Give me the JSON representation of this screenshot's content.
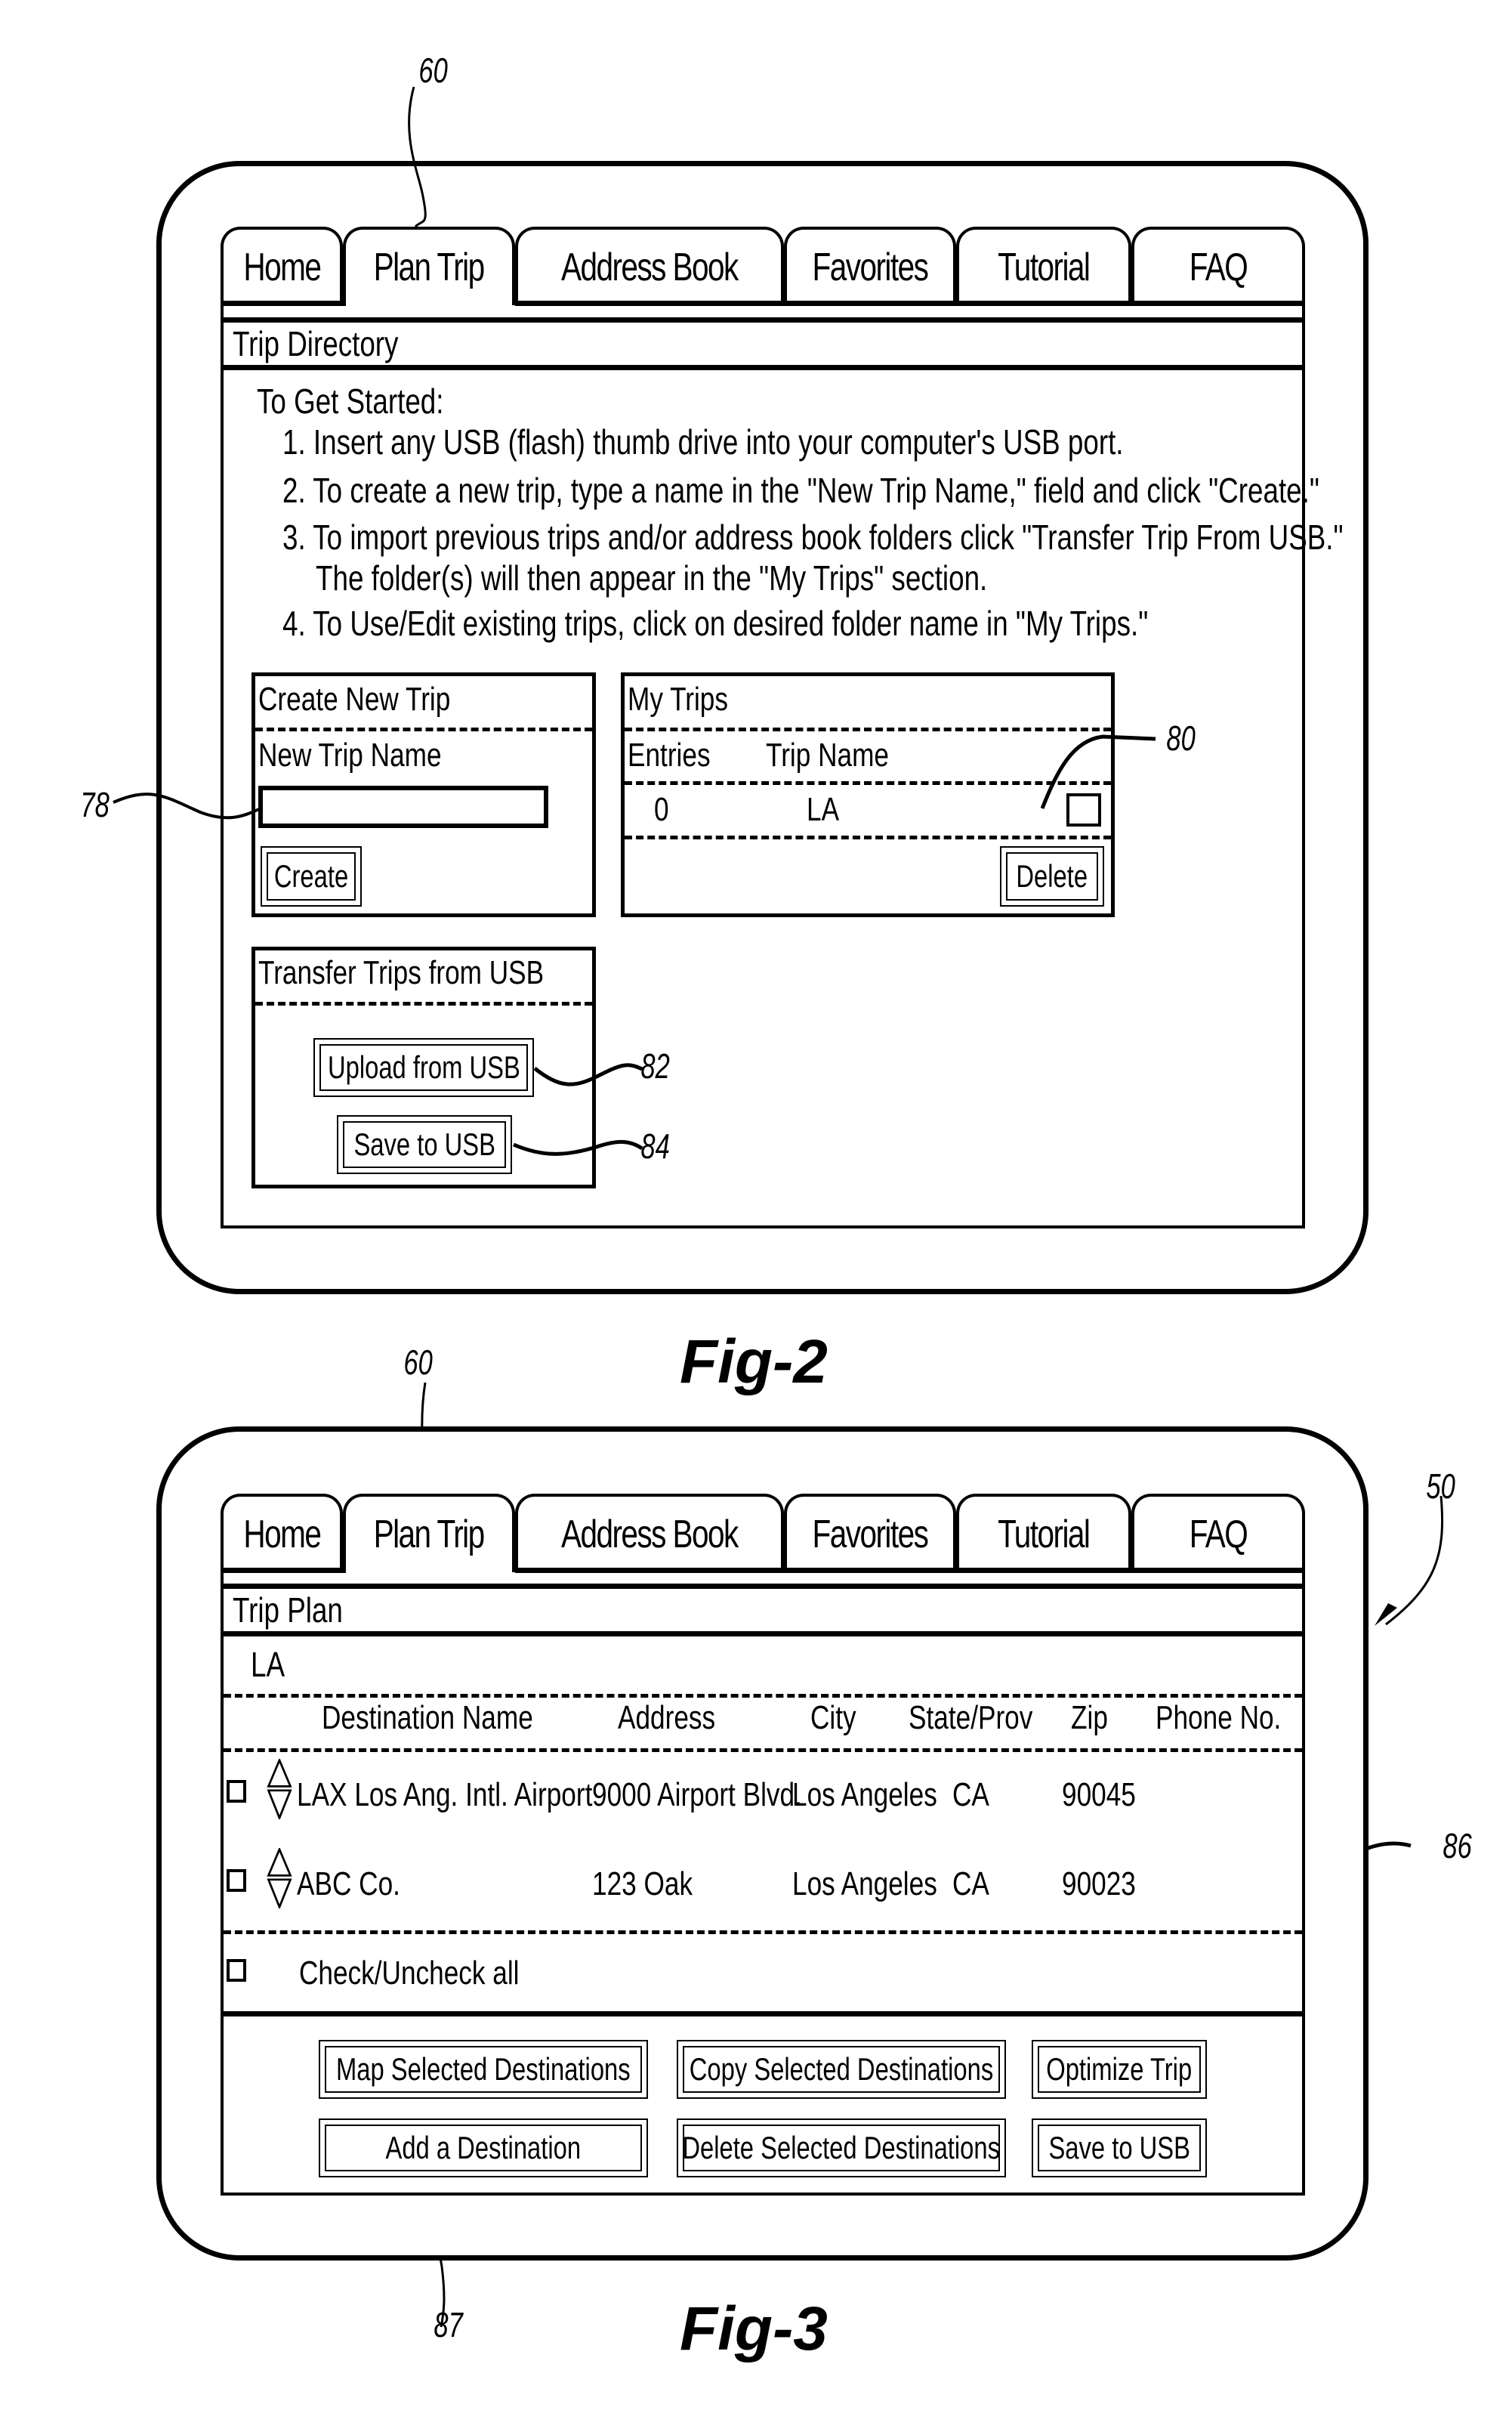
{
  "figures": [
    {
      "label": "Fig-2",
      "tabs": [
        "Home",
        "Plan Trip",
        "Address Book",
        "Favorites",
        "Tutorial",
        "FAQ"
      ],
      "active_tab": "Plan Trip",
      "section_title": "Trip Directory",
      "instructions": {
        "heading": "To Get Started:",
        "steps": [
          "1.  Insert any USB (flash) thumb drive into your computer's USB port.",
          "2.  To create a new trip, type a name in the \"New Trip Name,\" field and click \"Create.\"",
          "3.  To import previous trips and/or address book folders click \"Transfer Trip From USB.\"",
          "The folder(s) will then appear in the \"My Trips\" section.",
          "4.  To Use/Edit existing trips, click on desired folder name in \"My Trips.\""
        ]
      },
      "create_new_trip": {
        "title": "Create New Trip",
        "field_label": "New Trip Name",
        "field_value": "",
        "create_button": "Create"
      },
      "my_trips": {
        "title": "My Trips",
        "columns": [
          "Entries",
          "Trip Name"
        ],
        "rows": [
          {
            "entries": "0",
            "trip_name": "LA",
            "checked": false
          }
        ],
        "delete_button": "Delete"
      },
      "transfer": {
        "title": "Transfer Trips from USB",
        "upload_button": "Upload from USB",
        "save_button": "Save to USB"
      },
      "reference_numerals": {
        "tab": "60",
        "field": "78",
        "checkbox": "80",
        "upload": "82",
        "save": "84"
      }
    },
    {
      "label": "Fig-3",
      "tabs": [
        "Home",
        "Plan Trip",
        "Address Book",
        "Favorites",
        "Tutorial",
        "FAQ"
      ],
      "active_tab": "Plan Trip",
      "section_title": "Trip Plan",
      "trip_name": "LA",
      "table": {
        "columns": [
          "Destination Name",
          "Address",
          "City",
          "State/Prov",
          "Zip",
          "Phone No."
        ],
        "rows": [
          {
            "name": "LAX Los Ang. Intl. Airport",
            "address": "9000 Airport Blvd.",
            "city": "Los Angeles",
            "state": "CA",
            "zip": "90045",
            "phone": ""
          },
          {
            "name": "ABC Co.",
            "address": "123 Oak",
            "city": "Los Angeles",
            "state": "CA",
            "zip": "90023",
            "phone": ""
          }
        ]
      },
      "check_all_label": "Check/Uncheck all",
      "buttons": {
        "map_selected": "Map Selected Destinations",
        "copy_selected": "Copy Selected Destinations",
        "optimize": "Optimize Trip",
        "add_destination": "Add a Destination",
        "delete_selected": "Delete Selected Destinations",
        "save_usb": "Save to USB"
      },
      "reference_numerals": {
        "tab": "60",
        "device": "50",
        "table": "86",
        "add_button": "87"
      }
    }
  ]
}
